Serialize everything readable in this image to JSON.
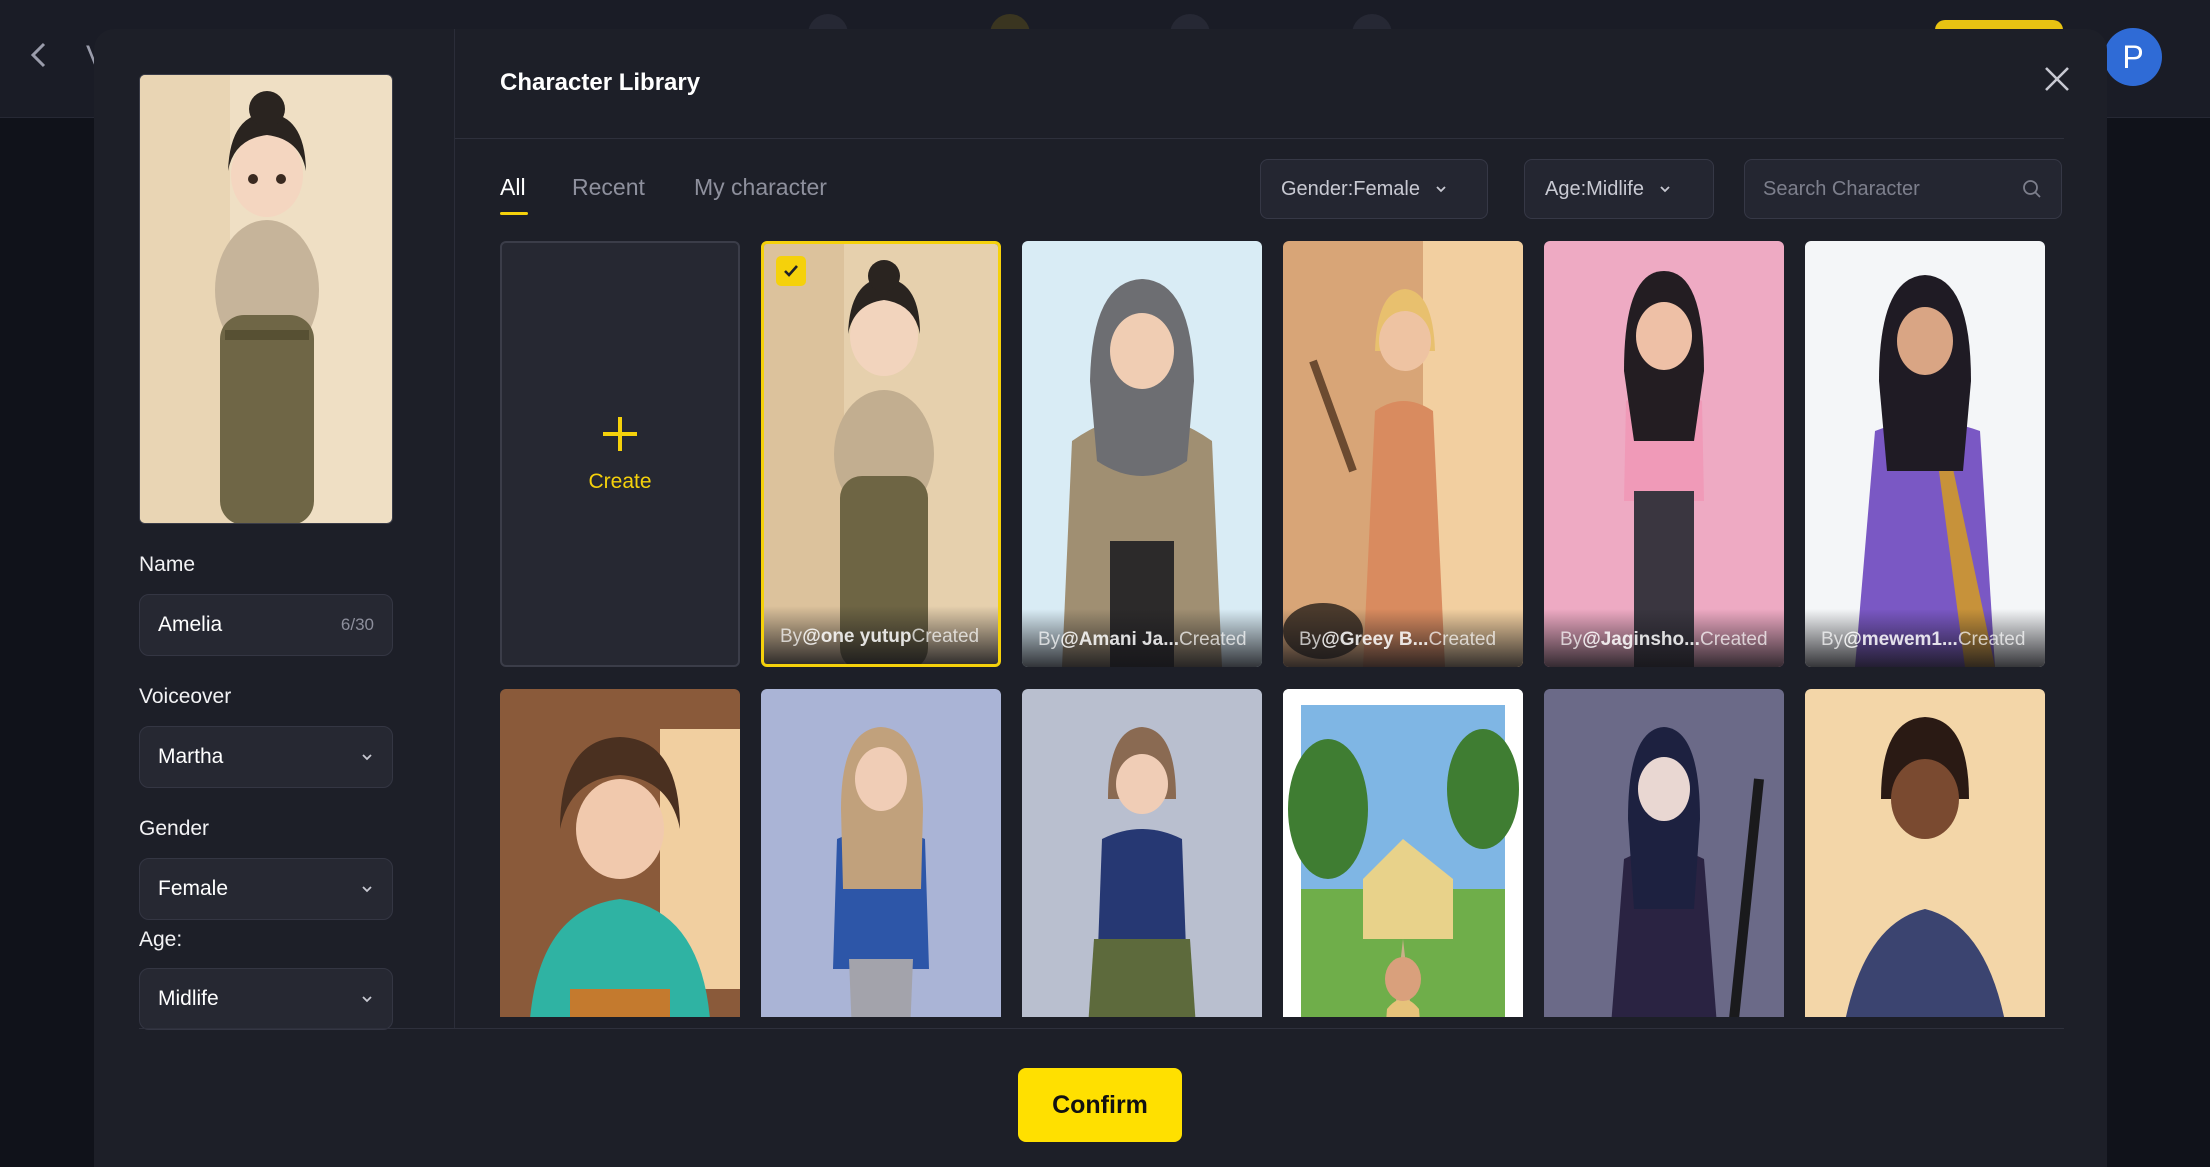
{
  "background": {
    "avatar_letter": "P",
    "partial_title": "V"
  },
  "modal": {
    "title": "Character Library",
    "close_icon": "close-icon"
  },
  "editor": {
    "name_label": "Name",
    "name_value": "Amelia",
    "name_counter": "6/30",
    "voiceover_label": "Voiceover",
    "voiceover_value": "Martha",
    "gender_label": "Gender",
    "gender_value": "Female",
    "age_label": "Age:",
    "age_value": "Midlife"
  },
  "tabs": [
    {
      "label": "All",
      "active": true
    },
    {
      "label": "Recent",
      "active": false
    },
    {
      "label": "My character",
      "active": false
    }
  ],
  "filters": {
    "gender": "Gender:Female",
    "age": "Age:Midlife",
    "search_placeholder": "Search Character"
  },
  "create_card": {
    "label": "Create"
  },
  "characters_row1": [
    {
      "by": "By ",
      "handle": "@one yutup",
      "created": " Created",
      "selected": true
    },
    {
      "by": "By ",
      "handle": "@Amani Ja...",
      "created": " Created",
      "selected": false
    },
    {
      "by": "By ",
      "handle": "@Greey B...",
      "created": " Created",
      "selected": false
    },
    {
      "by": "By ",
      "handle": "@Jaginsho...",
      "created": " Created",
      "selected": false
    },
    {
      "by": "By ",
      "handle": "@mewem1...",
      "created": " Created",
      "selected": false
    }
  ],
  "confirm_label": "Confirm",
  "colors": {
    "accent": "#f5d10b",
    "confirm": "#ffe000",
    "modal_bg": "#1d1f28",
    "avatar": "#2f6bd6"
  }
}
